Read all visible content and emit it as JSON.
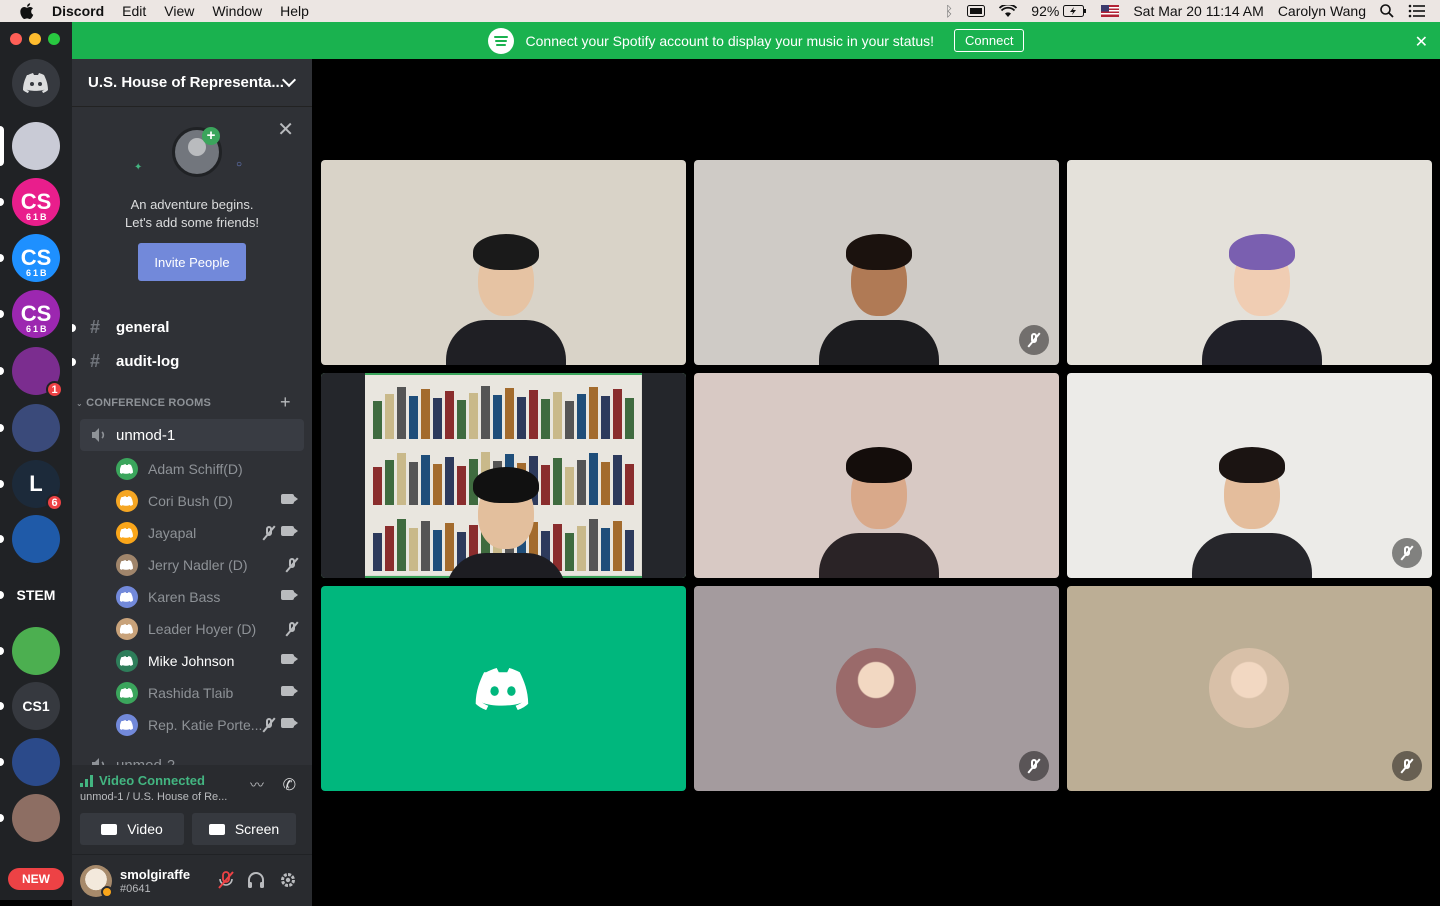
{
  "menubar": {
    "app": "Discord",
    "items": [
      "Edit",
      "View",
      "Window",
      "Help"
    ],
    "battery": "92%",
    "datetime": "Sat Mar 20  11:14 AM",
    "user": "Carolyn Wang"
  },
  "banner": {
    "text": "Connect your Spotify account to display your music in your status!",
    "button": "Connect",
    "close": "✕"
  },
  "servers": [
    {
      "label": "",
      "color": "#5865f2",
      "type": "home"
    },
    {
      "label": "",
      "color": "#c9cbd6",
      "type": "seal"
    },
    {
      "label": "CS",
      "color": "#e91e8c",
      "sub": "61B"
    },
    {
      "label": "CS",
      "color": "#1e90ff",
      "sub": "61B"
    },
    {
      "label": "CS",
      "color": "#9c27b0",
      "sub": "61B"
    },
    {
      "label": "",
      "color": "#7b2d8f",
      "badge": "1"
    },
    {
      "label": "",
      "color": "#3a4a7a"
    },
    {
      "label": "L",
      "color": "#1c2a3a",
      "badge": "6"
    },
    {
      "label": "",
      "color": "#1f5aa8"
    },
    {
      "label": "STEM",
      "color": "#202225"
    },
    {
      "label": "",
      "color": "#4caf50"
    },
    {
      "label": "CS1",
      "color": "#36393f"
    },
    {
      "label": "",
      "color": "#2b4a8a"
    },
    {
      "label": "",
      "color": "#8d6e63"
    },
    {
      "label": "",
      "color": "#202225"
    }
  ],
  "new_badge": "NEW",
  "sidebar": {
    "server_name": "U.S. House of Representa...",
    "friends_line1": "An adventure begins.",
    "friends_line2": "Let's add some friends!",
    "invite_button": "Invite People",
    "text_channels": [
      "general",
      "audit-log"
    ],
    "category": "CONFERENCE ROOMS",
    "voice_channels": [
      "unmod-1",
      "unmod-2"
    ],
    "voice_users": [
      {
        "name": "Adam Schiff(D)",
        "avatar_color": "#3ba55c",
        "muted": false,
        "video": false,
        "bright": false
      },
      {
        "name": "Cori Bush (D)",
        "avatar_color": "#f5a623",
        "muted": false,
        "video": true,
        "bright": false
      },
      {
        "name": "Jayapal",
        "avatar_color": "#faa61a",
        "muted": true,
        "video": true,
        "bright": false
      },
      {
        "name": "Jerry Nadler (D)",
        "avatar_color": "#a0856b",
        "muted": true,
        "video": false,
        "bright": false
      },
      {
        "name": "Karen Bass",
        "avatar_color": "#7289da",
        "muted": false,
        "video": true,
        "bright": false
      },
      {
        "name": "Leader Hoyer (D)",
        "avatar_color": "#c8a27a",
        "muted": true,
        "video": false,
        "bright": false
      },
      {
        "name": "Mike Johnson",
        "avatar_color": "#2e7d5a",
        "muted": false,
        "video": true,
        "bright": true
      },
      {
        "name": "Rashida Tlaib",
        "avatar_color": "#3ba55c",
        "muted": false,
        "video": true,
        "bright": false
      },
      {
        "name": "Rep. Katie Porte...",
        "avatar_color": "#7289da",
        "muted": true,
        "video": true,
        "bright": false
      }
    ]
  },
  "voice_panel": {
    "status": "Video Connected",
    "location": "unmod-1 / U.S. House of Re...",
    "video_button": "Video",
    "screen_button": "Screen"
  },
  "user_panel": {
    "username": "smolgiraffe",
    "tag": "#0641"
  },
  "tiles": [
    {
      "type": "video",
      "bg": "#d9d3c8",
      "muted": false,
      "speaking": false,
      "skin": "#e6c3a3",
      "hair": "#1a1a1a",
      "suit": "#1f1f24"
    },
    {
      "type": "video",
      "bg": "#cfcbc6",
      "muted": true,
      "speaking": false,
      "skin": "#b07a55",
      "hair": "#1b120e",
      "suit": "#1c1c1f"
    },
    {
      "type": "video",
      "bg": "#e4e1da",
      "muted": false,
      "speaking": false,
      "skin": "#f0cdb3",
      "hair": "#7a5fb0",
      "suit": "#202028"
    },
    {
      "type": "video",
      "bg": "#dedbd4",
      "muted": false,
      "speaking": true,
      "skin": "#e3bf9d",
      "hair": "#111111",
      "suit": "#1d1d22"
    },
    {
      "type": "video",
      "bg": "#d8c9c4",
      "muted": false,
      "speaking": false,
      "skin": "#d9a98a",
      "hair": "#140d0b",
      "suit": "#2a2326"
    },
    {
      "type": "video",
      "bg": "#ecebe8",
      "muted": true,
      "speaking": false,
      "skin": "#e4bd9c",
      "hair": "#1b1412",
      "suit": "#26262b"
    },
    {
      "type": "logo",
      "bg": "#00b77d",
      "muted": false
    },
    {
      "type": "avatar",
      "bg": "#a49b9e",
      "muted": true,
      "avatar_color": "#9a6a6a"
    },
    {
      "type": "avatar",
      "bg": "#bcae95",
      "muted": true,
      "avatar_color": "#d8c0a8"
    }
  ]
}
